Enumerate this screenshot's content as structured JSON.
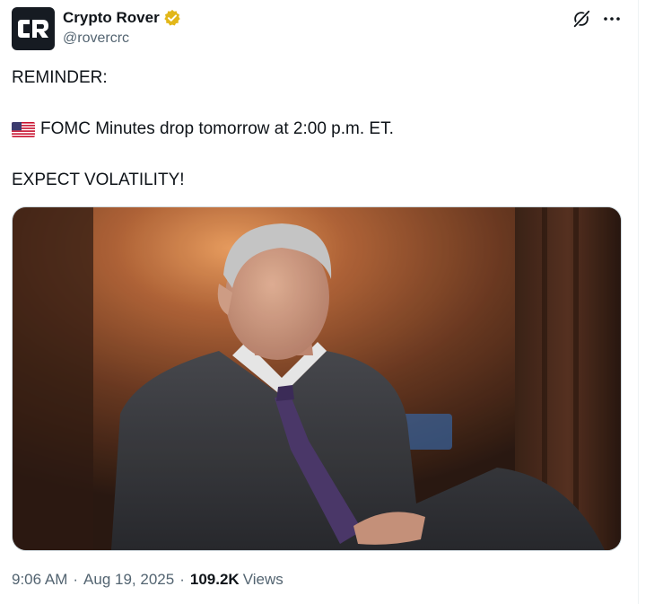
{
  "account": {
    "display_name": "Crypto Rover",
    "handle": "@rovercrc",
    "verified_badge": "gold-verified-icon",
    "avatar_monogram": "CR"
  },
  "header_actions": {
    "grok_icon": "grok-icon",
    "more_icon": "more-options-icon"
  },
  "tweet": {
    "line1": "REMINDER:",
    "line2_flag": "us-flag-icon",
    "line2": "FOMC Minutes drop tomorrow at 2:00 p.m. ET.",
    "line3": "EXPECT VOLATILITY!"
  },
  "meta": {
    "time": "9:06 AM",
    "separator": "·",
    "date": "Aug 19, 2025",
    "views_count": "109.2K",
    "views_label": "Views"
  },
  "colors": {
    "text_primary": "#0f1419",
    "text_secondary": "#536471",
    "verified_gold": "#e2b719",
    "border": "#cfd9de"
  }
}
